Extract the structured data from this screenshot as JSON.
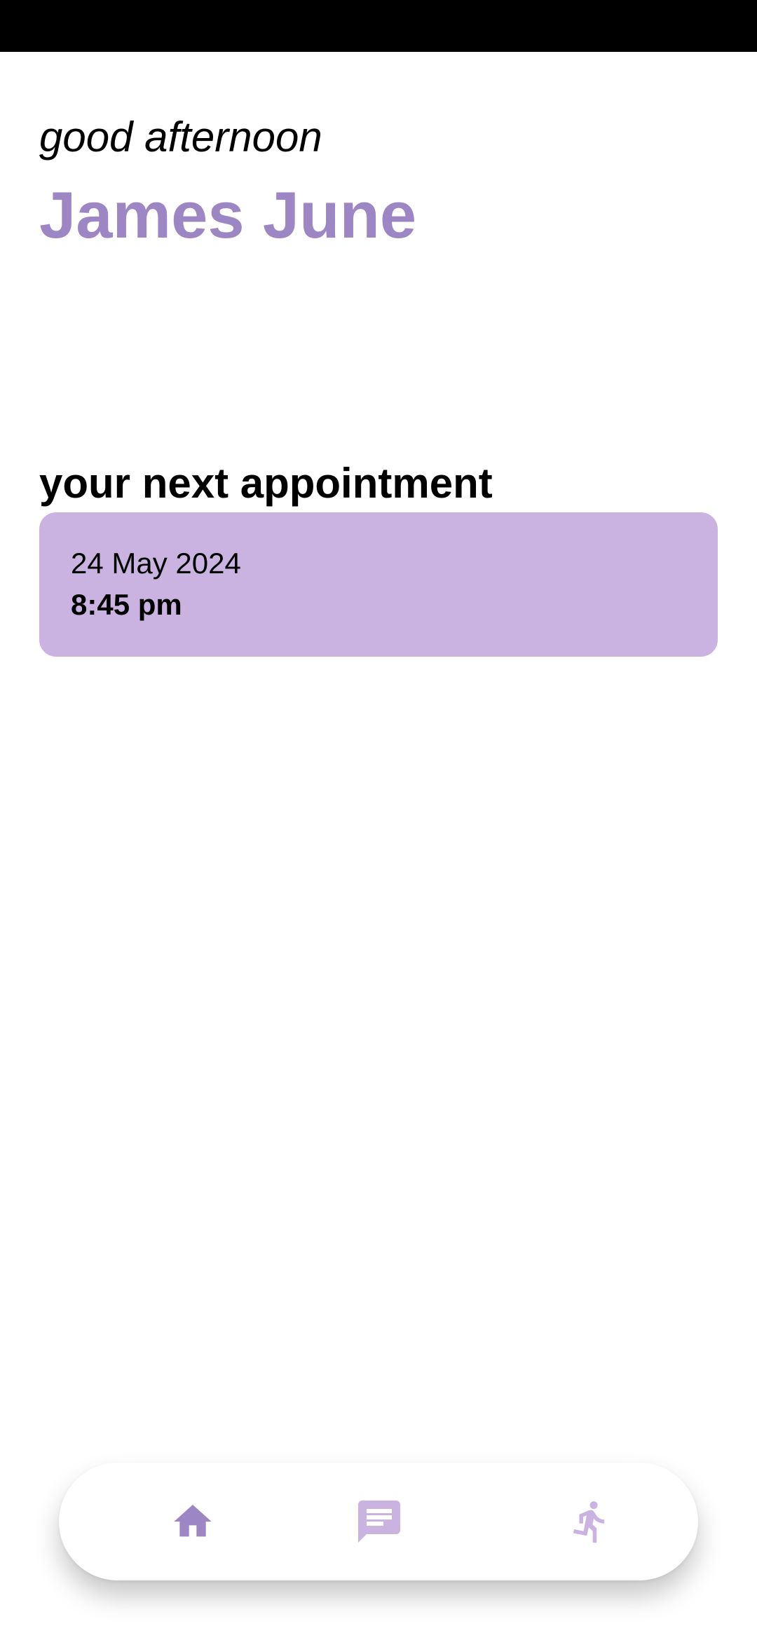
{
  "greeting": "good afternoon",
  "user_name": "James June",
  "appointment": {
    "heading": "your next appointment",
    "date": "24 May 2024",
    "time": "8:45 pm"
  },
  "nav": {
    "items": [
      {
        "icon": "home-icon",
        "active": true
      },
      {
        "icon": "chat-icon",
        "active": false
      },
      {
        "icon": "running-person-icon",
        "active": false
      }
    ]
  },
  "colors": {
    "accent": "#9c86c4",
    "accent_light": "#cab3e1",
    "card_background": "#cab3e1",
    "status_bar": "#000000"
  }
}
